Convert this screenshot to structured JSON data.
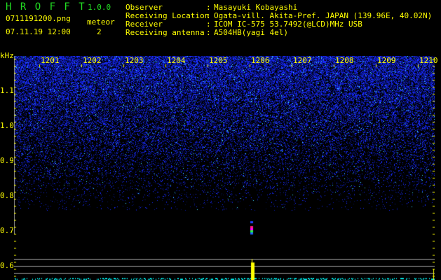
{
  "app": {
    "title": "H R O F F T",
    "version": "1.0.0"
  },
  "file": {
    "name": "0711191200.png",
    "datetime": "07.11.19 12:00"
  },
  "meteor": {
    "label": "meteor",
    "count": "2"
  },
  "info": [
    {
      "label": "Observer",
      "value": "Masayuki Kobayashi"
    },
    {
      "label": "Receiving Location",
      "value": "Ogata-vill. Akita-Pref. JAPAN (139.96E, 40.02N)"
    },
    {
      "label": "Receiver",
      "value": "ICOM IC-575 53.7492(@LCD)MHz USB"
    },
    {
      "label": "Receiving antenna",
      "value": "A504HB(yagi 4el)"
    }
  ],
  "axes": {
    "y_unit": "kHz",
    "y_ticks": [
      "1.1",
      "1.0",
      "0.9",
      "0.8",
      "0.7",
      "0.6"
    ],
    "x_ticks": [
      "1201",
      "1202",
      "1203",
      "1204",
      "1205",
      "1206",
      "1207",
      "1208",
      "1209",
      "1210"
    ]
  },
  "colors": {
    "text": "#ffff00",
    "title": "#22dd22",
    "noise": "#1a2cff",
    "meteor_bar": "#ffff00",
    "baseline": "#00e0e0"
  }
}
